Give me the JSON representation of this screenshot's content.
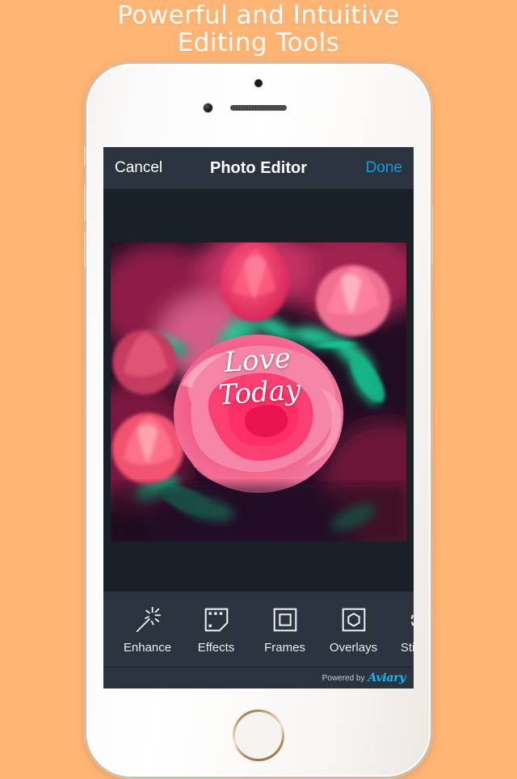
{
  "promo": {
    "headline": "Powerful and Intuitive\nEditing Tools",
    "background_color": "#FFB473",
    "headline_color": "#FFFFFF"
  },
  "device": {
    "name": "white-gold-smartphone",
    "body_color": "#F7F5F2",
    "home_button": "home-button",
    "buttons": [
      "silent-switch",
      "volume-up",
      "volume-down",
      "power"
    ]
  },
  "screen": {
    "background_color": "#1A2028",
    "header": {
      "cancel_label": "Cancel",
      "title": "Photo Editor",
      "done_label": "Done",
      "bar_color": "#2B333F",
      "done_color": "#0A9FE8"
    },
    "photo": {
      "alt": "pink roses close-up",
      "overlay_text": "Love\nToday",
      "overlay_color": "#FFFFFF"
    },
    "toolbar": {
      "bar_color": "#2B333F",
      "items": [
        {
          "label": "Enhance",
          "icon": "magic-wand-icon"
        },
        {
          "label": "Effects",
          "icon": "film-strip-icon"
        },
        {
          "label": "Frames",
          "icon": "square-frame-icon"
        },
        {
          "label": "Overlays",
          "icon": "hexagon-in-square-icon"
        },
        {
          "label": "Stickers",
          "icon": "sticker-icon"
        }
      ]
    },
    "footer": {
      "powered_by": "Powered by",
      "brand": "Aviary",
      "brand_color": "#18B6F2"
    }
  }
}
